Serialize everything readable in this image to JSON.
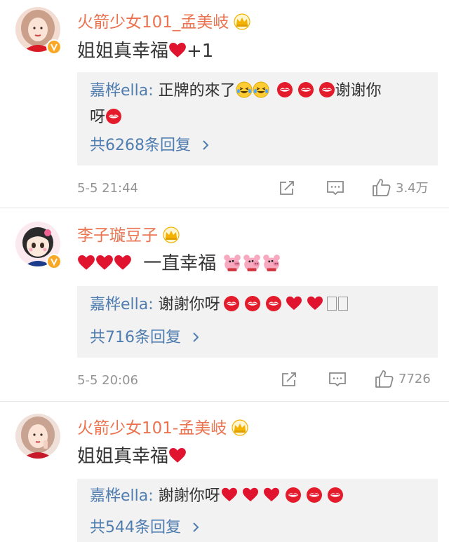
{
  "comments": [
    {
      "username": "火箭少女101_孟美岐",
      "text": "姐姐真幸福",
      "text_suffix": "+1",
      "reply_author": "嘉桦ella:",
      "reply_text": " 正牌的來了",
      "reply_text2": "谢谢你",
      "reply_text3": "呀",
      "reply_count": "共6268条回复",
      "time": "5-5 21:44",
      "likes": "3.4万"
    },
    {
      "username": "李子璇豆子",
      "text": "一直幸福",
      "reply_author": "嘉桦ella:",
      "reply_text": " 谢謝你呀",
      "reply_count": "共716条回复",
      "time": "5-5 20:06",
      "likes": "7726"
    },
    {
      "username": "火箭少女101-孟美岐",
      "text": "姐姐真幸福",
      "reply_author": "嘉桦ella:",
      "reply_text": " 謝謝你呀",
      "reply_count": "共544条回复"
    }
  ],
  "icons": {
    "repost": "repost-icon",
    "comment": "comment-icon",
    "like": "thumbs-up-icon",
    "chevron": "chevron-right-icon",
    "crown": "crown-badge-icon",
    "verified": "verified-v-icon"
  },
  "colors": {
    "username": "#eb7350",
    "link": "#507daf",
    "meta": "#939393",
    "reply_bg": "#f2f2f2",
    "heart": "#e0245e"
  }
}
